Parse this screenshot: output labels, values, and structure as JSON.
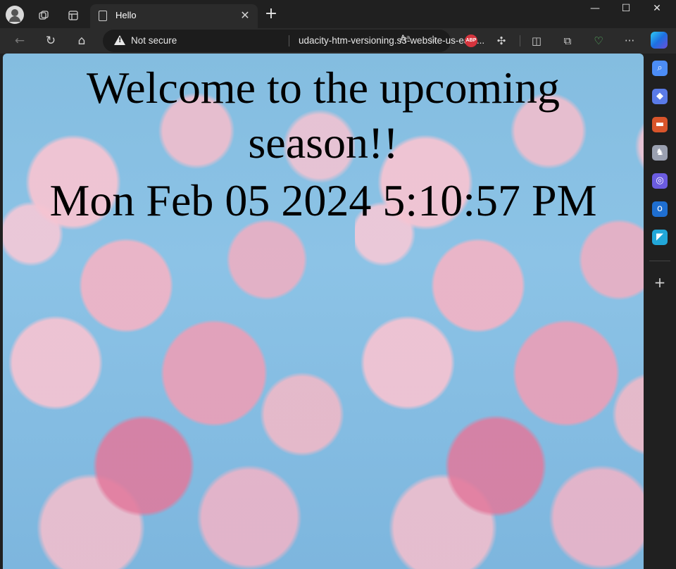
{
  "browser": {
    "tab": {
      "title": "Hello",
      "close_glyph": "✕"
    },
    "new_tab_glyph": "+",
    "window_controls": {
      "minimize": "—",
      "maximize": "☐",
      "close": "✕"
    },
    "address_bar": {
      "security_text": "Not secure",
      "url": "udacity-htm-versioning.s3-website-us-east..."
    },
    "extensions": {
      "adblock_label": "ABP"
    },
    "icons": {
      "profile": "avatar-icon",
      "workspaces": "workspaces-icon",
      "tab_actions": "tab-actions-icon",
      "back": "back-arrow-icon",
      "refresh": "refresh-icon",
      "home": "home-icon",
      "warning": "warning-icon",
      "read_aloud": "read-aloud-icon",
      "favorite": "star-icon",
      "extensions": "puzzle-icon",
      "split_screen": "split-screen-icon",
      "collections": "collections-icon",
      "health": "browser-essentials-icon",
      "more": "more-icon",
      "copilot": "copilot-icon"
    }
  },
  "page": {
    "heading_line1": "Welcome to the upcoming",
    "heading_line2": "season!!",
    "datetime": "Mon Feb 05 2024 5:10:57 PM"
  },
  "sidebar": {
    "items": [
      {
        "name": "search",
        "color": "#4c8df6",
        "glyph": "⌕"
      },
      {
        "name": "shopping",
        "color": "#5a7be8",
        "glyph": "◆"
      },
      {
        "name": "tools",
        "color": "#d9552b",
        "glyph": "▬"
      },
      {
        "name": "games",
        "color": "#9aa0b0",
        "glyph": "♞"
      },
      {
        "name": "microsoft-365",
        "color": "#6b5ce0",
        "glyph": "◎"
      },
      {
        "name": "outlook",
        "color": "#1f6fd1",
        "glyph": "o"
      },
      {
        "name": "drop",
        "color": "#22a7d8",
        "glyph": "◤"
      }
    ],
    "add_glyph": "+"
  }
}
